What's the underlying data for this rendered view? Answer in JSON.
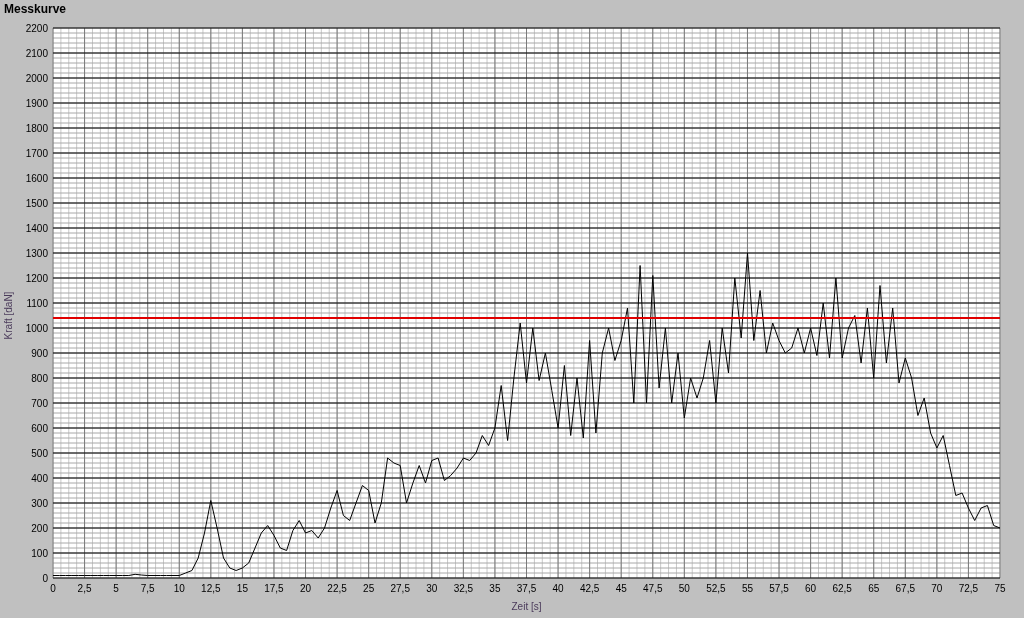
{
  "chart_data": {
    "type": "line",
    "title": "Messkurve",
    "grid": true,
    "xlabel": "Zeit [s]",
    "ylabel": "Kraft [daN]",
    "x": [
      0,
      0.5,
      1,
      1.5,
      2,
      2.5,
      3,
      3.5,
      4,
      4.5,
      5,
      5.5,
      6,
      6.5,
      7,
      7.5,
      8,
      8.5,
      9,
      9.5,
      10,
      10.5,
      11,
      11.5,
      12,
      12.5,
      13,
      13.5,
      14,
      14.5,
      15,
      15.5,
      16,
      16.5,
      17,
      17.5,
      18,
      18.5,
      19,
      19.5,
      20,
      20.5,
      21,
      21.5,
      22,
      22.5,
      23,
      23.5,
      24,
      24.5,
      25,
      25.5,
      26,
      26.5,
      27,
      27.5,
      28,
      28.5,
      29,
      29.5,
      30,
      30.5,
      31,
      31.5,
      32,
      32.5,
      33,
      33.5,
      34,
      34.5,
      35,
      35.5,
      36,
      36.5,
      37,
      37.5,
      38,
      38.5,
      39,
      39.5,
      40,
      40.5,
      41,
      41.5,
      42,
      42.5,
      43,
      43.5,
      44,
      44.5,
      45,
      45.5,
      46,
      46.5,
      47,
      47.5,
      48,
      48.5,
      49,
      49.5,
      50,
      50.5,
      51,
      51.5,
      52,
      52.5,
      53,
      53.5,
      54,
      54.5,
      55,
      55.5,
      56,
      56.5,
      57,
      57.5,
      58,
      58.5,
      59,
      59.5,
      60,
      60.5,
      61,
      61.5,
      62,
      62.5,
      63,
      63.5,
      64,
      64.5,
      65,
      65.5,
      66,
      66.5,
      67,
      67.5,
      68,
      68.5,
      69,
      69.5,
      70,
      70.5,
      71,
      71.5,
      72,
      72.5,
      73,
      73.5,
      74,
      74.5,
      75
    ],
    "series": [
      {
        "color": "#000000",
        "values": [
          10,
          10,
          10,
          10,
          10,
          10,
          10,
          10,
          10,
          10,
          10,
          10,
          10,
          15,
          12,
          10,
          10,
          10,
          10,
          10,
          10,
          20,
          30,
          80,
          180,
          310,
          200,
          80,
          40,
          30,
          40,
          60,
          120,
          180,
          210,
          170,
          120,
          110,
          190,
          230,
          180,
          190,
          160,
          200,
          280,
          350,
          250,
          230,
          300,
          370,
          350,
          220,
          300,
          480,
          460,
          450,
          300,
          380,
          450,
          380,
          470,
          480,
          390,
          410,
          440,
          480,
          470,
          500,
          570,
          530,
          600,
          770,
          550,
          800,
          1020,
          780,
          1000,
          790,
          900,
          750,
          600,
          850,
          570,
          800,
          560,
          950,
          580,
          900,
          1000,
          870,
          950,
          1080,
          700,
          1250,
          700,
          1210,
          760,
          1000,
          700,
          900,
          640,
          800,
          720,
          800,
          950,
          700,
          1000,
          820,
          1200,
          960,
          1300,
          950,
          1150,
          900,
          1020,
          950,
          900,
          920,
          1000,
          900,
          1000,
          890,
          1100,
          880,
          1200,
          880,
          1000,
          1050,
          860,
          1080,
          800,
          1170,
          860,
          1080,
          780,
          880,
          800,
          650,
          720,
          580,
          520,
          570,
          450,
          330,
          340,
          280,
          230,
          280,
          290,
          210,
          200
        ]
      },
      {
        "color": "#e00000",
        "values": [
          1040,
          1040,
          1040,
          1040,
          1040,
          1040,
          1040,
          1040,
          1040,
          1040,
          1040,
          1040,
          1040,
          1040,
          1040,
          1040,
          1040,
          1040,
          1040,
          1040,
          1040,
          1040,
          1040,
          1040,
          1040,
          1040,
          1040,
          1040,
          1040,
          1040,
          1040,
          1040,
          1040,
          1040,
          1040,
          1040,
          1040,
          1040,
          1040,
          1040,
          1040,
          1040,
          1040,
          1040,
          1040,
          1040,
          1040,
          1040,
          1040,
          1040,
          1040,
          1040,
          1040,
          1040,
          1040,
          1040,
          1040,
          1040,
          1040,
          1040,
          1040,
          1040,
          1040,
          1040,
          1040,
          1040,
          1040,
          1040,
          1040,
          1040,
          1040,
          1040,
          1040,
          1040,
          1040,
          1040,
          1040,
          1040,
          1040,
          1040,
          1040,
          1040,
          1040,
          1040,
          1040,
          1040,
          1040,
          1040,
          1040,
          1040,
          1040,
          1040,
          1040,
          1040,
          1040,
          1040,
          1040,
          1040,
          1040,
          1040,
          1040,
          1040,
          1040,
          1040,
          1040,
          1040,
          1040,
          1040,
          1040,
          1040,
          1040,
          1040,
          1040,
          1040,
          1040,
          1040,
          1040,
          1040,
          1040,
          1040,
          1040,
          1040,
          1040,
          1040,
          1040,
          1040,
          1040,
          1040,
          1040,
          1040,
          1040,
          1040,
          1040,
          1040,
          1040,
          1040,
          1040,
          1040,
          1040,
          1040,
          1040,
          1040,
          1040,
          1040,
          1040,
          1040,
          1040,
          1040,
          1040,
          1040,
          1040
        ]
      }
    ],
    "xlim": [
      0,
      75
    ],
    "ylim": [
      0,
      2200
    ],
    "xticks": [
      {
        "value": 0,
        "label": "0"
      },
      {
        "value": 2.5,
        "label": "2,5"
      },
      {
        "value": 5,
        "label": "5"
      },
      {
        "value": 7.5,
        "label": "7,5"
      },
      {
        "value": 10,
        "label": "10"
      },
      {
        "value": 12.5,
        "label": "12,5"
      },
      {
        "value": 15,
        "label": "15"
      },
      {
        "value": 17.5,
        "label": "17,5"
      },
      {
        "value": 20,
        "label": "20"
      },
      {
        "value": 22.5,
        "label": "22,5"
      },
      {
        "value": 25,
        "label": "25"
      },
      {
        "value": 27.5,
        "label": "27,5"
      },
      {
        "value": 30,
        "label": "30"
      },
      {
        "value": 32.5,
        "label": "32,5"
      },
      {
        "value": 35,
        "label": "35"
      },
      {
        "value": 37.5,
        "label": "37,5"
      },
      {
        "value": 40,
        "label": "40"
      },
      {
        "value": 42.5,
        "label": "42,5"
      },
      {
        "value": 45,
        "label": "45"
      },
      {
        "value": 47.5,
        "label": "47,5"
      },
      {
        "value": 50,
        "label": "50"
      },
      {
        "value": 52.5,
        "label": "52,5"
      },
      {
        "value": 55,
        "label": "55"
      },
      {
        "value": 57.5,
        "label": "57,5"
      },
      {
        "value": 60,
        "label": "60"
      },
      {
        "value": 62.5,
        "label": "62,5"
      },
      {
        "value": 65,
        "label": "65"
      },
      {
        "value": 67.5,
        "label": "67,5"
      },
      {
        "value": 70,
        "label": "70"
      },
      {
        "value": 72.5,
        "label": "72,5"
      },
      {
        "value": 75,
        "label": "75"
      }
    ],
    "yticks": [
      0,
      100,
      200,
      300,
      400,
      500,
      600,
      700,
      800,
      900,
      1000,
      1100,
      1200,
      1300,
      1400,
      1500,
      1600,
      1700,
      1800,
      1900,
      2000,
      2100,
      2200
    ]
  }
}
